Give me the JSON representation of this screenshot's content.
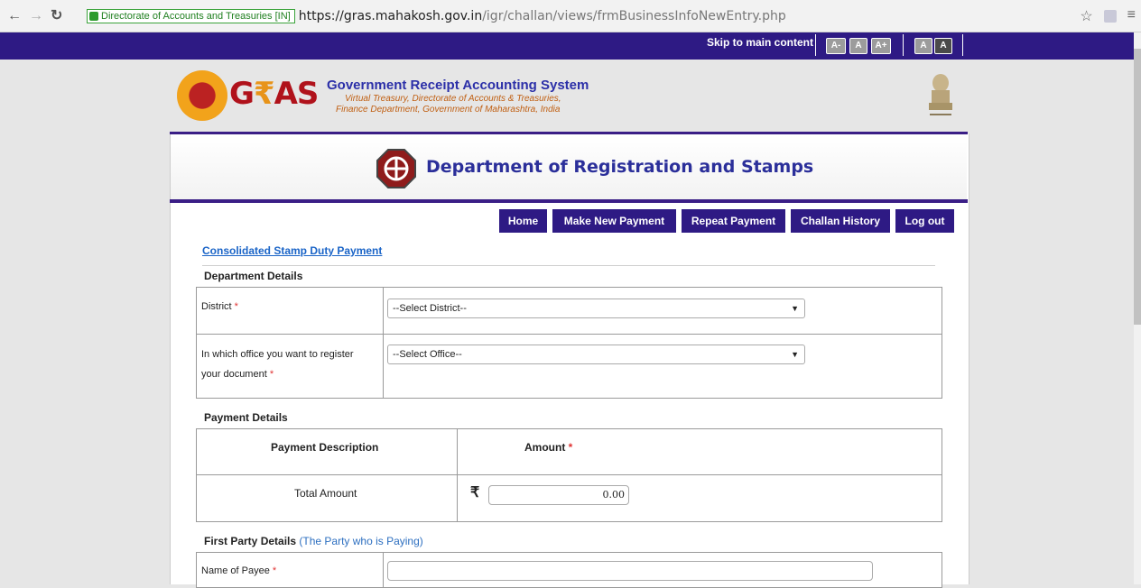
{
  "browser": {
    "secure_label": "Directorate of Accounts and Treasuries [IN]",
    "url_domain": "https://gras.mahakosh.gov.in",
    "url_path": "/igr/challan/views/frmBusinessInfoNewEntry.php",
    "back_icon": "back-arrow-icon",
    "forward_icon": "forward-arrow-icon",
    "reload_icon": "reload-icon",
    "star_icon": "star-icon",
    "menu_icon": "hamburger-menu-icon"
  },
  "topbar": {
    "skip_link": "Skip to main content",
    "font_buttons": [
      "A-",
      "A",
      "A+"
    ],
    "contrast_buttons": [
      "A",
      "A"
    ]
  },
  "header": {
    "logo_text_g": "G",
    "logo_text_r": "₹",
    "logo_text_as": "AS",
    "title": "Government Receipt Accounting System",
    "subtitle_line1": "Virtual Treasury, Directorate of Accounts & Treasuries,",
    "subtitle_line2": "Finance Department, Government of Maharashtra, India"
  },
  "department": {
    "title": "Department of Registration and Stamps"
  },
  "nav": {
    "items": [
      "Home",
      "Make New Payment",
      "Repeat Payment",
      "Challan History",
      "Log out"
    ]
  },
  "form": {
    "consolidated_link": "Consolidated Stamp Duty Payment",
    "department_details": {
      "heading": "Department Details",
      "district_label": "District",
      "district_placeholder": "--Select District--",
      "office_label_line1": "In which office you want to register",
      "office_label_line2": "your document",
      "office_placeholder": "--Select Office--",
      "required_mark": "*"
    },
    "payment_details": {
      "heading": "Payment Details",
      "col_description": "Payment Description",
      "col_amount": "Amount",
      "total_label": "Total Amount",
      "currency_symbol": "₹",
      "total_value": "0.00"
    },
    "first_party": {
      "heading": "First Party Details",
      "heading_note": "(The Party who is Paying)",
      "payee_label": "Name of Payee",
      "payee_value": ""
    }
  },
  "colors": {
    "accent_purple": "#2e1a84",
    "link_blue": "#1a64c7",
    "required_red": "#e03333"
  }
}
